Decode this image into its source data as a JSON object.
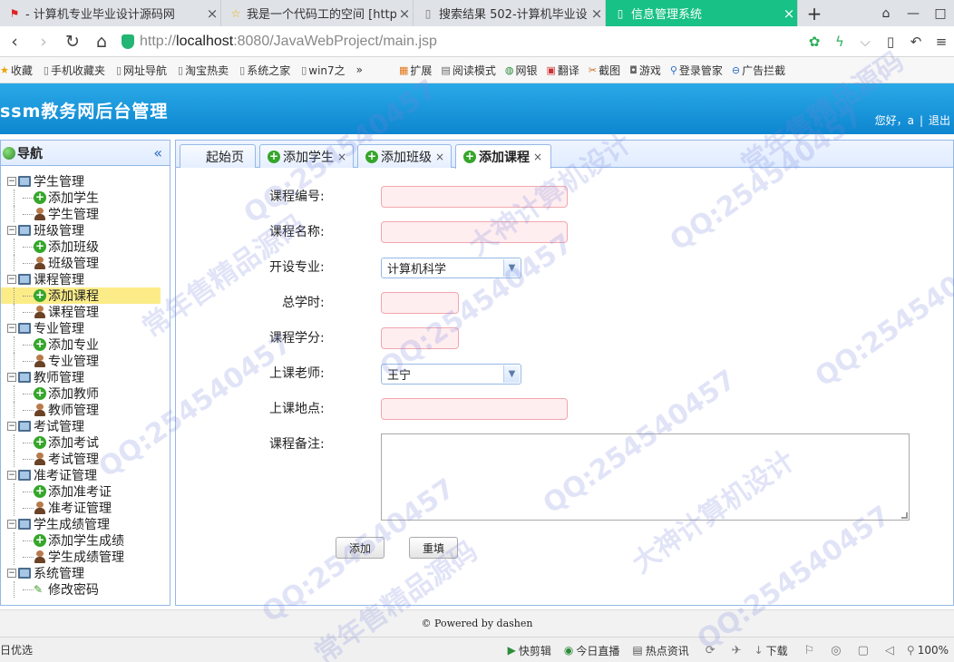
{
  "browser": {
    "tabs": [
      {
        "title": "- 计算机专业毕业设计源码网",
        "icon": "red-flag-icon"
      },
      {
        "title": "我是一个代码工的空间 [http",
        "icon": "star-icon"
      },
      {
        "title": "搜索结果 502-计算机毕业设",
        "icon": "page-icon"
      },
      {
        "title": "信息管理系统",
        "icon": "page-icon"
      }
    ],
    "url": {
      "scheme": "http://",
      "host": "localhost",
      "rest": ":8080/JavaWebProject/main.jsp"
    },
    "bookmarks": [
      "收藏",
      "手机收藏夹",
      "网址导航",
      "淘宝热卖",
      "系统之家",
      "win7之",
      "»"
    ],
    "toolbar": [
      "扩展",
      "阅读模式",
      "网银",
      "翻译",
      "截图",
      "游戏",
      "登录管家",
      "广告拦截"
    ],
    "colors": {
      "active_tab": "#18c186",
      "secure": "#22b573"
    }
  },
  "app": {
    "title": "ssm教务网后台管理",
    "greeting": "您好，a",
    "logout": "退出",
    "colors": {
      "header": "#0d86cf",
      "panel_border": "#95b8e7",
      "selected": "#fbec88"
    }
  },
  "nav": {
    "title": "导航",
    "collapse_glyph": "«",
    "groups": [
      {
        "label": "学生管理",
        "items": [
          {
            "label": "添加学生",
            "icon": "add-icon"
          },
          {
            "label": "学生管理",
            "icon": "user-icon"
          }
        ]
      },
      {
        "label": "班级管理",
        "items": [
          {
            "label": "添加班级",
            "icon": "add-icon"
          },
          {
            "label": "班级管理",
            "icon": "user-icon"
          }
        ]
      },
      {
        "label": "课程管理",
        "items": [
          {
            "label": "添加课程",
            "icon": "add-icon",
            "selected": true
          },
          {
            "label": "课程管理",
            "icon": "user-icon"
          }
        ]
      },
      {
        "label": "专业管理",
        "items": [
          {
            "label": "添加专业",
            "icon": "add-icon"
          },
          {
            "label": "专业管理",
            "icon": "user-icon"
          }
        ]
      },
      {
        "label": "教师管理",
        "items": [
          {
            "label": "添加教师",
            "icon": "add-icon"
          },
          {
            "label": "教师管理",
            "icon": "user-icon"
          }
        ]
      },
      {
        "label": "考试管理",
        "items": [
          {
            "label": "添加考试",
            "icon": "add-icon"
          },
          {
            "label": "考试管理",
            "icon": "user-icon"
          }
        ]
      },
      {
        "label": "准考证管理",
        "items": [
          {
            "label": "添加准考证",
            "icon": "add-icon"
          },
          {
            "label": "准考证管理",
            "icon": "user-icon"
          }
        ]
      },
      {
        "label": "学生成绩管理",
        "items": [
          {
            "label": "添加学生成绩",
            "icon": "add-icon"
          },
          {
            "label": "学生成绩管理",
            "icon": "user-icon"
          }
        ]
      },
      {
        "label": "系统管理",
        "items": [
          {
            "label": "修改密码",
            "icon": "pencil-icon"
          }
        ]
      }
    ]
  },
  "content_tabs": [
    {
      "label": "起始页",
      "closable": false
    },
    {
      "label": "添加学生",
      "closable": true
    },
    {
      "label": "添加班级",
      "closable": true
    },
    {
      "label": "添加课程",
      "closable": true,
      "active": true
    }
  ],
  "form": {
    "course_no": {
      "label": "课程编号:",
      "value": ""
    },
    "course_name": {
      "label": "课程名称:",
      "value": ""
    },
    "major": {
      "label": "开设专业:",
      "value": "计算机科学"
    },
    "total_hours": {
      "label": "总学时:",
      "value": ""
    },
    "credits": {
      "label": "课程学分:",
      "value": ""
    },
    "teacher": {
      "label": "上课老师:",
      "value": "王宁"
    },
    "location": {
      "label": "上课地点:",
      "value": ""
    },
    "remark": {
      "label": "课程备注:",
      "value": ""
    },
    "submit_label": "添加",
    "reset_label": "重填"
  },
  "footer": {
    "text": "© Powered by dashen"
  },
  "statusbar": {
    "left": "日优选",
    "items": [
      "快剪辑",
      "今日直播",
      "热点资讯",
      "下载"
    ],
    "zoom": "100%"
  },
  "watermarks": [
    "QQ:254540457",
    "大神计算机设计",
    "常年售精品源码"
  ]
}
